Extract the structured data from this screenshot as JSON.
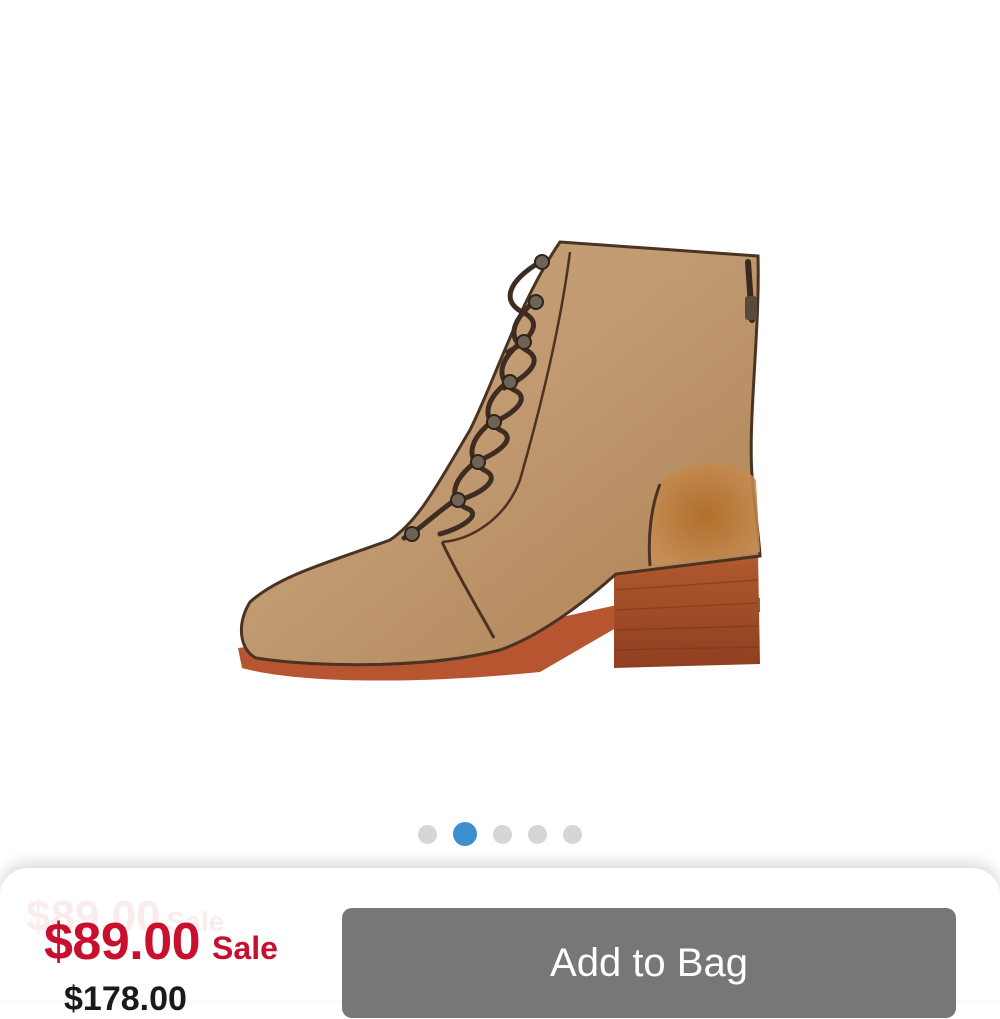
{
  "product": {
    "image_alt": "Lace-up leather ankle boot with stacked heel",
    "gallery": {
      "total_images": 5,
      "active_index": 1
    }
  },
  "pricing": {
    "sale_price": "$89.00",
    "sale_label": "Sale",
    "original_price": "$178.00"
  },
  "actions": {
    "add_to_bag_label": "Add to Bag"
  },
  "colors": {
    "sale_red": "#c8102e",
    "active_dot": "#3d8fce",
    "inactive_dot": "#d6d6d6",
    "button_gray": "#777777"
  }
}
